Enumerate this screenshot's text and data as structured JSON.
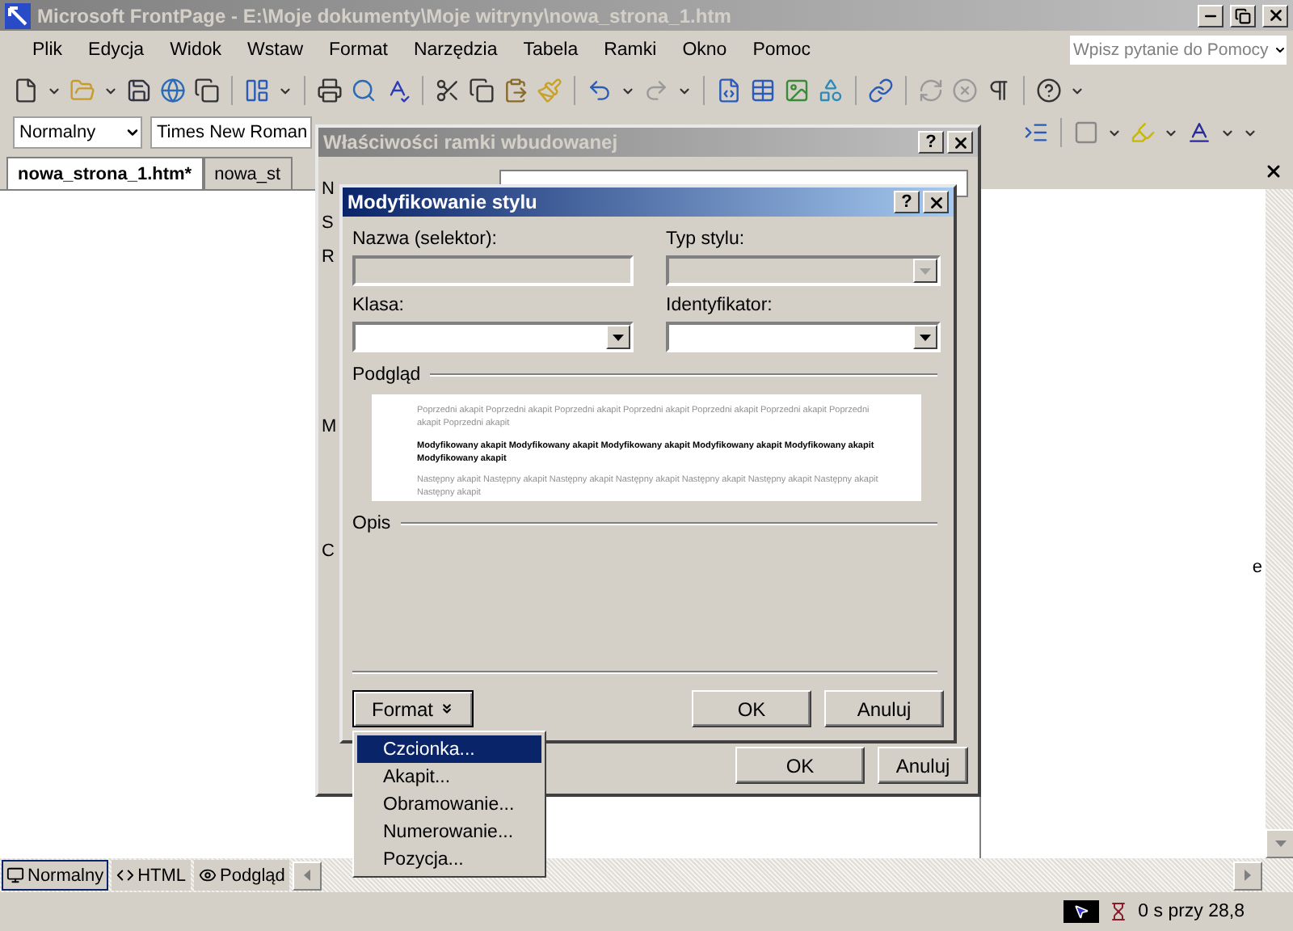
{
  "window": {
    "title": "Microsoft FrontPage - E:\\Moje dokumenty\\Moje witryny\\nowa_strona_1.htm"
  },
  "menu": [
    "Plik",
    "Edycja",
    "Widok",
    "Wstaw",
    "Format",
    "Narzędzia",
    "Tabela",
    "Ramki",
    "Okno",
    "Pomoc"
  ],
  "help_search": {
    "placeholder": "Wpisz pytanie do Pomocy"
  },
  "formatting": {
    "style": "Normalny",
    "font": "Times New Roman"
  },
  "document_tabs": [
    {
      "label": "nowa_strona_1.htm*",
      "selected": true
    },
    {
      "label": "nowa_st",
      "selected": false
    }
  ],
  "task_pane": {
    "fragment": "e"
  },
  "view_tabs": [
    {
      "label": "Normalny",
      "selected": true
    },
    {
      "label": "HTML",
      "selected": false
    },
    {
      "label": "Podgląd",
      "selected": false
    }
  ],
  "status_bar": {
    "download_time": "0 s przy 28,8"
  },
  "frame_dialog": {
    "title": "Właściwości ramki wbudowanej",
    "help_button": "?",
    "label_fragments": [
      "N",
      "S",
      "R",
      "M",
      "C"
    ],
    "buttons": [
      "OK",
      "Anuluj"
    ]
  },
  "style_dialog": {
    "title": "Modyfikowanie stylu",
    "help_button": "?",
    "fields": [
      {
        "label": "Nazwa (selektor):",
        "kind": "text",
        "disabled": true
      },
      {
        "label": "Typ stylu:",
        "kind": "dropdown",
        "disabled": true
      },
      {
        "label": "Klasa:",
        "kind": "dropdown",
        "disabled": false
      },
      {
        "label": "Identyfikator:",
        "kind": "dropdown",
        "disabled": false
      }
    ],
    "preview_label": "Podgląd",
    "preview": {
      "previous": "Poprzedni akapit Poprzedni akapit Poprzedni akapit Poprzedni akapit Poprzedni akapit Poprzedni akapit Poprzedni akapit Poprzedni akapit",
      "modified": "Modyfikowany akapit Modyfikowany akapit Modyfikowany akapit Modyfikowany akapit Modyfikowany akapit Modyfikowany akapit",
      "next": "Następny akapit Następny akapit Następny akapit Następny akapit Następny akapit Następny akapit Następny akapit Następny akapit"
    },
    "description_label": "Opis",
    "format_button": "Format",
    "buttons": [
      "OK",
      "Anuluj"
    ]
  },
  "format_menu": [
    {
      "label": "Czcionka...",
      "selected": true
    },
    {
      "label": "Akapit...",
      "selected": false
    },
    {
      "label": "Obramowanie...",
      "selected": false
    },
    {
      "label": "Numerowanie...",
      "selected": false
    },
    {
      "label": "Pozycja...",
      "selected": false
    }
  ]
}
